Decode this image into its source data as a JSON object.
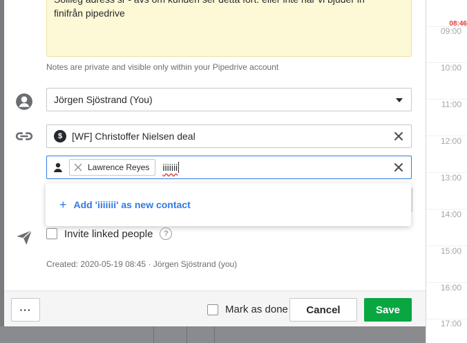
{
  "note": {
    "text_line1": "Sollieg adress sr - avs om kunden ser detta fort. eller inte når vi bjuder in",
    "text_line2": "finifrån pipedrive",
    "help": "Notes are private and visible only within your Pipedrive account"
  },
  "owner": {
    "value": "Jörgen Sjöstrand (You)"
  },
  "deal": {
    "icon": "$",
    "value": "[WF] Christoffer Nielsen deal"
  },
  "participants": {
    "chip_label": "Lawrence Reyes",
    "typed_value": "iiiiiii"
  },
  "dropdown": {
    "plus": "+",
    "add_label": "Add 'iiiiiii' as new contact"
  },
  "invite": {
    "label": "Invite linked people",
    "help": "?"
  },
  "created": "Created: 2020-05-19 08:45 · Jörgen Sjöstrand (you)",
  "footer": {
    "more_label": "···",
    "mark_done_label": "Mark as done",
    "cancel_label": "Cancel",
    "save_label": "Save"
  },
  "calendar": {
    "now": "08:46",
    "hours": [
      "09:00",
      "10:00",
      "11:00",
      "12:00",
      "13:00",
      "14:00",
      "15:00",
      "16:00",
      "17:00"
    ]
  },
  "colors": {
    "accent": "#317ae2",
    "save": "#08a742",
    "note_bg": "#fdf9d6",
    "now": "#e03a3a"
  }
}
